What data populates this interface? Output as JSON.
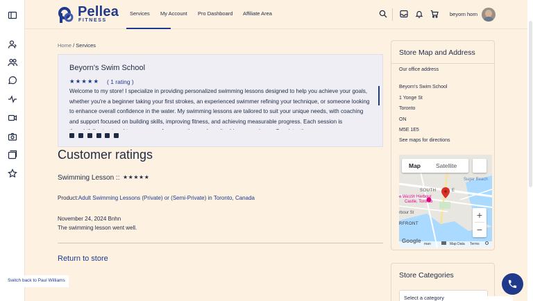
{
  "topnav": {
    "brand": "Pellea",
    "brand_sub": "FITNESS",
    "items": [
      "Services",
      "My Account",
      "Pro Dashboard",
      "Affiliate Area"
    ],
    "active": "Services",
    "username": "beyorn horn"
  },
  "breadcrumb": {
    "home": "Home",
    "sep": " / ",
    "current": "Services"
  },
  "store": {
    "name": "Beyorn's Swim School",
    "stars": "★★★★★",
    "rating_text": "( 1 rating )",
    "description": "Welcome to my store! I specialize in providing personalized swimming lessons designed to help you achieve your goals, whether you're a beginner taking your first strokes, an experienced swimmer refining your technique, or someone looking to enhance overall confidence in the water. My swimming lessons are tailored to suit your unique needs, with coaching and support focused on building skills, improving fitness, and achieving measurable progress. Each session is thoughtfully structured to ensure a safe, supportive, and results-driven experience. Consistently"
  },
  "ratings": {
    "section_title": "Customer ratings",
    "lesson_title": "Swimming Lesson ::",
    "lesson_stars": "★★★★★",
    "product_prefix": "Product:",
    "product_link": "Adult Swimming Lessons (Private) or (Semi-Private) in Toronto, Canada",
    "date": "November 24, 2024 Bnhn",
    "review": "The swimming lesson went well."
  },
  "return_link": "Return to store",
  "sidebar": {
    "map_title": "Store Map and Address",
    "office_label": "Our office address",
    "address_lines": [
      "Beyorn's Swim School",
      "1 Yonge St",
      "Toronto",
      "ON",
      "M5E 1E5"
    ],
    "directions": "See maps for directions",
    "categories_title": "Store Categories",
    "category_placeholder": "Select a category"
  },
  "map": {
    "tab_map": "Map",
    "tab_satellite": "Satellite",
    "label_sugar": "Sugar Beach",
    "label_south": "SOUTH",
    "label_south_end": "E",
    "label_westin_1": "e Westin Harbour",
    "label_westin_2": "Castle, Toronto",
    "label_harbour": "rbour St",
    "label_front": "RFRONT",
    "google": "Google",
    "footer_man": "man",
    "footer_data": "Map Data",
    "footer_terms": "Terms",
    "zoom_in": "+",
    "zoom_out": "−"
  },
  "switch_back": "Switch back to Paul Williams",
  "colors": {
    "brand": "#1f3a8a",
    "background": "#fdf1e2",
    "card": "#eeeef4"
  }
}
